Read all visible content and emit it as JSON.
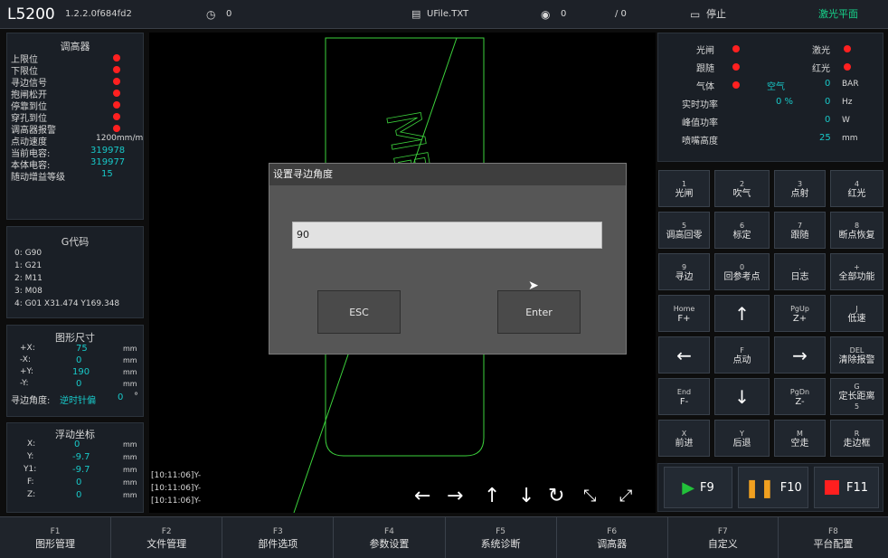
{
  "topbar": {
    "model": "L5200",
    "version": "1.2.2.0f684fd2",
    "speed": "0",
    "file": "UFile.TXT",
    "count": "0",
    "progress": "/ 0",
    "status": "停止",
    "plane": "激光平面"
  },
  "regulator": {
    "title": "调高器",
    "items": [
      "上限位",
      "下限位",
      "寻边信号",
      "抱闸松开",
      "停靠到位",
      "穿孔到位",
      "调高器报警"
    ],
    "jog_speed_label": "点动速度",
    "jog_speed_value": "1200mm/m",
    "cur_cap_label": "当前电容:",
    "cur_cap_value": "319978",
    "body_cap_label": "本体电容:",
    "body_cap_value": "319977",
    "gain_label": "随动增益等级",
    "gain_value": "15"
  },
  "gcode": {
    "title": "G代码",
    "lines": [
      "0: G90",
      "1: G21",
      "2: M11",
      "3: M08",
      "4: G01 X31.474 Y169.348"
    ]
  },
  "shape": {
    "title": "图形尺寸",
    "rows": [
      {
        "axis": "+X:",
        "value": "75",
        "unit": "mm"
      },
      {
        "axis": "-X:",
        "value": "0",
        "unit": "mm"
      },
      {
        "axis": "+Y:",
        "value": "190",
        "unit": "mm"
      },
      {
        "axis": "-Y:",
        "value": "0",
        "unit": "mm"
      }
    ],
    "edge_label": "寻边角度:",
    "edge_dir": "逆时针偏",
    "edge_value": "0",
    "edge_unit": "°"
  },
  "coords": {
    "title": "浮动坐标",
    "rows": [
      {
        "axis": "X:",
        "value": "0",
        "unit": "mm"
      },
      {
        "axis": "Y:",
        "value": "-9.7",
        "unit": "mm"
      },
      {
        "axis": "Y1:",
        "value": "-9.7",
        "unit": "mm"
      },
      {
        "axis": "F:",
        "value": "0",
        "unit": "mm"
      },
      {
        "axis": "Z:",
        "value": "0",
        "unit": "mm"
      }
    ]
  },
  "canvas": {
    "part_text": "MB02",
    "log": [
      "[10:11:06]Y-",
      "[10:11:06]Y-",
      "[10:11:06]Y-"
    ]
  },
  "laser_status": {
    "shutter": "光闸",
    "laser": "激光",
    "follow": "跟随",
    "red_light": "红光",
    "gas": "气体",
    "gas_type": "空气",
    "gas_value": "0",
    "gas_unit": "BAR",
    "real_power_label": "实时功率",
    "real_power_pct": "0 %",
    "real_power_hz": "0",
    "hz_unit": "Hz",
    "peak_power_label": "峰值功率",
    "peak_power_value": "0",
    "peak_unit": "W",
    "nozzle_label": "喷嘴高度",
    "nozzle_value": "25",
    "nozzle_unit": "mm"
  },
  "keys": [
    {
      "top": "1",
      "label": "光闸"
    },
    {
      "top": "2",
      "label": "吹气"
    },
    {
      "top": "3",
      "label": "点射"
    },
    {
      "top": "4",
      "label": "红光"
    },
    {
      "top": "5",
      "label": "调高回零"
    },
    {
      "top": "6",
      "label": "标定"
    },
    {
      "top": "7",
      "label": "跟随"
    },
    {
      "top": "8",
      "label": "断点恢复"
    },
    {
      "top": "9",
      "label": "寻边"
    },
    {
      "top": "0",
      "label": "回参考点"
    },
    {
      "top": ".",
      "label": "日志"
    },
    {
      "top": "+",
      "label": "全部功能"
    },
    {
      "top": "Home",
      "label": "F+"
    },
    {
      "top": "",
      "label": "↑"
    },
    {
      "top": "PgUp",
      "label": "Z+"
    },
    {
      "top": "J",
      "label": "低速"
    },
    {
      "top": "",
      "label": "←"
    },
    {
      "top": "F",
      "label": "点动"
    },
    {
      "top": "",
      "label": "→"
    },
    {
      "top": "DEL",
      "label": "清除报警"
    },
    {
      "top": "End",
      "label": "F-"
    },
    {
      "top": "",
      "label": "↓"
    },
    {
      "top": "PgDn",
      "label": "Z-"
    },
    {
      "top": "G",
      "label": "定长距离"
    },
    {
      "top": "X",
      "label": "前进"
    },
    {
      "top": "Y",
      "label": "后退"
    },
    {
      "top": "M",
      "label": "空走"
    },
    {
      "top": "R",
      "label": "走边框"
    }
  ],
  "run": {
    "f9": "F9",
    "f10": "F10",
    "f11": "F11"
  },
  "bottom": [
    {
      "key": "F1",
      "label": "图形管理"
    },
    {
      "key": "F2",
      "label": "文件管理"
    },
    {
      "key": "F3",
      "label": "部件选项"
    },
    {
      "key": "F4",
      "label": "参数设置"
    },
    {
      "key": "F5",
      "label": "系统诊断"
    },
    {
      "key": "F6",
      "label": "调高器"
    },
    {
      "key": "F7",
      "label": "自定义"
    },
    {
      "key": "F8",
      "label": "平台配置"
    }
  ],
  "dialog": {
    "title": "设置寻边角度",
    "value": "90",
    "esc": "ESC",
    "enter": "Enter"
  },
  "extra": {
    "key5_bottom": "5"
  },
  "colors": {
    "accent": "#17d28a",
    "cyan": "#18c8c8",
    "alarm": "#ff2020",
    "path": "#3cd23c"
  }
}
